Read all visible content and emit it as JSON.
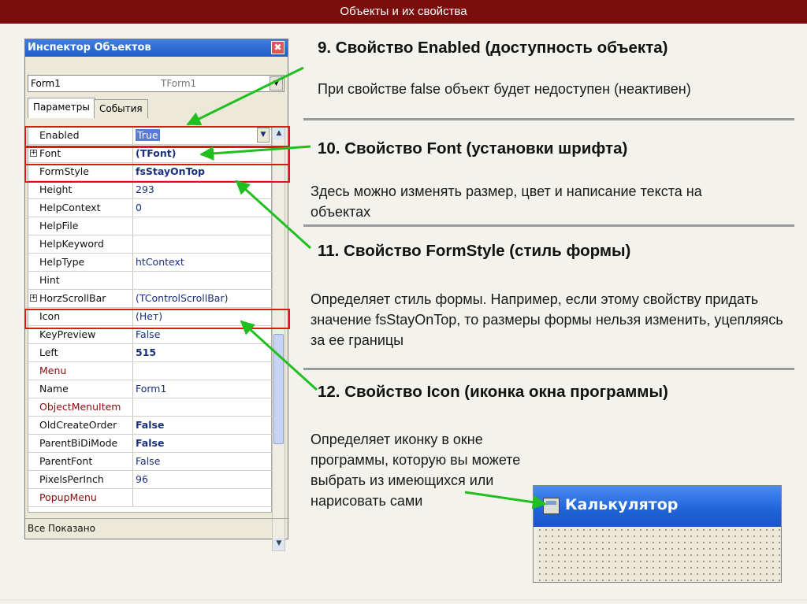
{
  "slide": {
    "title": "Объекты и их свойства"
  },
  "inspector": {
    "title": "Инспектор Объектов",
    "close_glyph": "✖",
    "object_name": "Form1",
    "object_class": "TForm1",
    "tabs": [
      "Параметры",
      "События"
    ],
    "status": "Все Показано",
    "properties": [
      {
        "name": "Enabled",
        "value": "True",
        "expandable": false,
        "red": false,
        "bold": false
      },
      {
        "name": "Font",
        "value": "(TFont)",
        "expandable": true,
        "red": false,
        "bold": true
      },
      {
        "name": "FormStyle",
        "value": "fsStayOnTop",
        "expandable": false,
        "red": false,
        "bold": true
      },
      {
        "name": "Height",
        "value": "293",
        "expandable": false,
        "red": false,
        "bold": false
      },
      {
        "name": "HelpContext",
        "value": "0",
        "expandable": false,
        "red": false,
        "bold": false
      },
      {
        "name": "HelpFile",
        "value": "",
        "expandable": false,
        "red": false,
        "bold": false
      },
      {
        "name": "HelpKeyword",
        "value": "",
        "expandable": false,
        "red": false,
        "bold": false
      },
      {
        "name": "HelpType",
        "value": "htContext",
        "expandable": false,
        "red": false,
        "bold": false
      },
      {
        "name": "Hint",
        "value": "",
        "expandable": false,
        "red": false,
        "bold": false
      },
      {
        "name": "HorzScrollBar",
        "value": "(TControlScrollBar)",
        "expandable": true,
        "red": false,
        "bold": false
      },
      {
        "name": "Icon",
        "value": "(Нет)",
        "expandable": false,
        "red": false,
        "bold": false
      },
      {
        "name": "KeyPreview",
        "value": "False",
        "expandable": false,
        "red": false,
        "bold": false
      },
      {
        "name": "Left",
        "value": "515",
        "expandable": false,
        "red": false,
        "bold": true
      },
      {
        "name": "Menu",
        "value": "",
        "expandable": false,
        "red": true,
        "bold": false
      },
      {
        "name": "Name",
        "value": "Form1",
        "expandable": false,
        "red": false,
        "bold": false
      },
      {
        "name": "ObjectMenuItem",
        "value": "",
        "expandable": false,
        "red": true,
        "bold": false
      },
      {
        "name": "OldCreateOrder",
        "value": "False",
        "expandable": false,
        "red": false,
        "bold": true
      },
      {
        "name": "ParentBiDiMode",
        "value": "False",
        "expandable": false,
        "red": false,
        "bold": true
      },
      {
        "name": "ParentFont",
        "value": "False",
        "expandable": false,
        "red": false,
        "bold": false
      },
      {
        "name": "PixelsPerInch",
        "value": "96",
        "expandable": false,
        "red": false,
        "bold": false
      },
      {
        "name": "PopupMenu",
        "value": "",
        "expandable": false,
        "red": true,
        "bold": false
      }
    ]
  },
  "sections": [
    {
      "heading": "9. Свойство Enabled (доступность объекта)",
      "text": "При свойстве false объект будет недоступен (неактивен)"
    },
    {
      "heading": "10. Свойство Font (установки шрифта)",
      "text": "Здесь можно изменять размер, цвет и написание текста на объектах"
    },
    {
      "heading": "11. Свойство FormStyle (стиль формы)",
      "text": "Определяет стиль формы. Например, если этому свойству придать значение fsStayOnTop, то размеры формы нельзя изменить, уцепляясь за ее границы"
    },
    {
      "heading": "12. Свойство Icon (иконка окна программы)",
      "text": "Определяет иконку в окне программы, которую вы можете выбрать из имеющихся или нарисовать сами"
    }
  ],
  "calculator": {
    "title": "Калькулятор",
    "icon": "calculator-icon"
  },
  "colors": {
    "title_bar": "#7b0c0c",
    "highlight": "#e01515",
    "arrow": "#1fbf1f"
  }
}
